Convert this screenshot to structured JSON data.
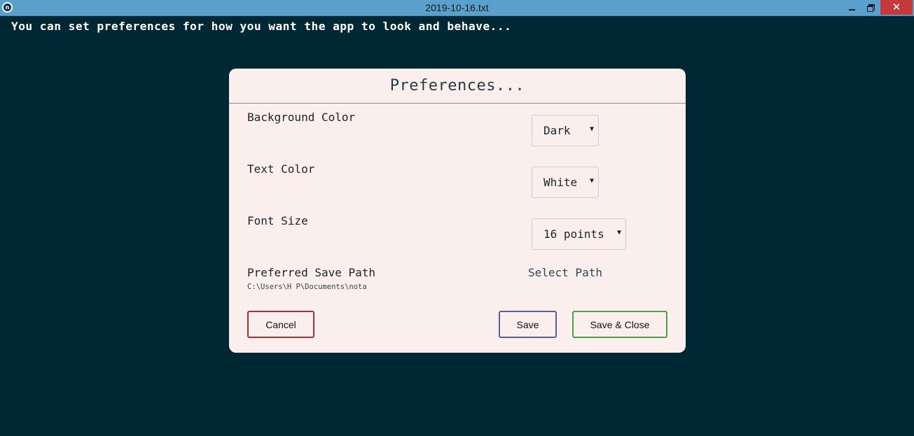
{
  "window": {
    "title": "2019-10-16.txt",
    "icon": "n",
    "controls": {
      "minimize": "minimize-icon",
      "restore": "restore-icon",
      "close_glyph": "✕"
    }
  },
  "editor": {
    "text": "You can set preferences for how you want the app to look and behave..."
  },
  "dialog": {
    "title": "Preferences...",
    "background_color": {
      "label": "Background Color",
      "selected": "Dark"
    },
    "text_color": {
      "label": "Text Color",
      "selected": "White"
    },
    "font_size": {
      "label": "Font Size",
      "selected": "16 points"
    },
    "save_path": {
      "label": "Preferred Save Path",
      "value": "C:\\Users\\H P\\Documents\\nota",
      "select_label": "Select Path"
    },
    "buttons": {
      "cancel": "Cancel",
      "save": "Save",
      "save_close": "Save & Close"
    }
  },
  "colors": {
    "app_background": "#002834",
    "titlebar": "#5aa0cc",
    "dialog_background": "#fbefed",
    "cancel_border": "#a82f36",
    "save_border": "#5a5ea0",
    "save_close_border": "#4d9e4d",
    "close_button": "#c7383a"
  }
}
